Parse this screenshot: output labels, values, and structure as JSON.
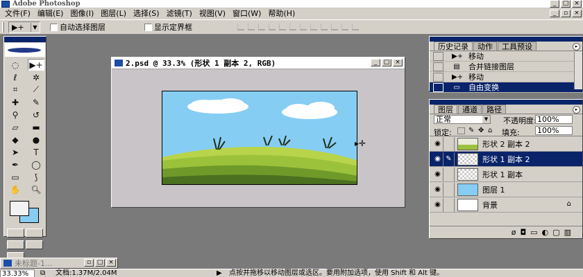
{
  "app": {
    "title": "Adobe Photoshop"
  },
  "menu": [
    "文件(F)",
    "编辑(E)",
    "图像(I)",
    "图层(L)",
    "选择(S)",
    "滤镜(T)",
    "视图(V)",
    "窗口(W)",
    "帮助(H)"
  ],
  "options": {
    "auto_select_label": "自动选择图层",
    "show_bounds_label": "显示定界框"
  },
  "document": {
    "title": "2.psd @ 33.3% (形状 1 副本 2, RGB)"
  },
  "history_panel": {
    "tabs": [
      "历史记录",
      "动作",
      "工具预设"
    ],
    "items": [
      {
        "label": "移动",
        "icon": "move-icon",
        "selected": false
      },
      {
        "label": "合并链接图层",
        "icon": "merge-icon",
        "selected": false
      },
      {
        "label": "移动",
        "icon": "move-icon",
        "selected": false
      },
      {
        "label": "自由变换",
        "icon": "transform-icon",
        "selected": true
      }
    ]
  },
  "layers_panel": {
    "tabs": [
      "图层",
      "通道",
      "路径"
    ],
    "blend_mode": "正常",
    "opacity_label": "不透明度:",
    "opacity_value": "100%",
    "lock_label": "锁定:",
    "fill_label": "填充:",
    "fill_value": "100%",
    "layers": [
      {
        "name": "形状 2 副本 2",
        "thumb": "grass",
        "selected": false,
        "linked": false
      },
      {
        "name": "形状 1 副本 2",
        "thumb": "checker",
        "selected": true,
        "linked": true
      },
      {
        "name": "形状 1 副本",
        "thumb": "checker",
        "selected": false,
        "linked": false
      },
      {
        "name": "图层 1",
        "thumb": "sky",
        "selected": false,
        "linked": false
      },
      {
        "name": "背景",
        "thumb": "white",
        "selected": false,
        "linked": false,
        "locked": true
      }
    ]
  },
  "minimized_doc": {
    "title": "未标题-1..."
  },
  "status": {
    "zoom": "33.33%",
    "doc_size": "文档:1.37M/2.04M",
    "hint": "点按并拖移以移动图层或选区。要用附加选项，使用 Shift 和 Alt 键。"
  },
  "colors": {
    "foreground": "#f2f2f2",
    "background": "#88ccf0",
    "selection": "#0a246a"
  }
}
